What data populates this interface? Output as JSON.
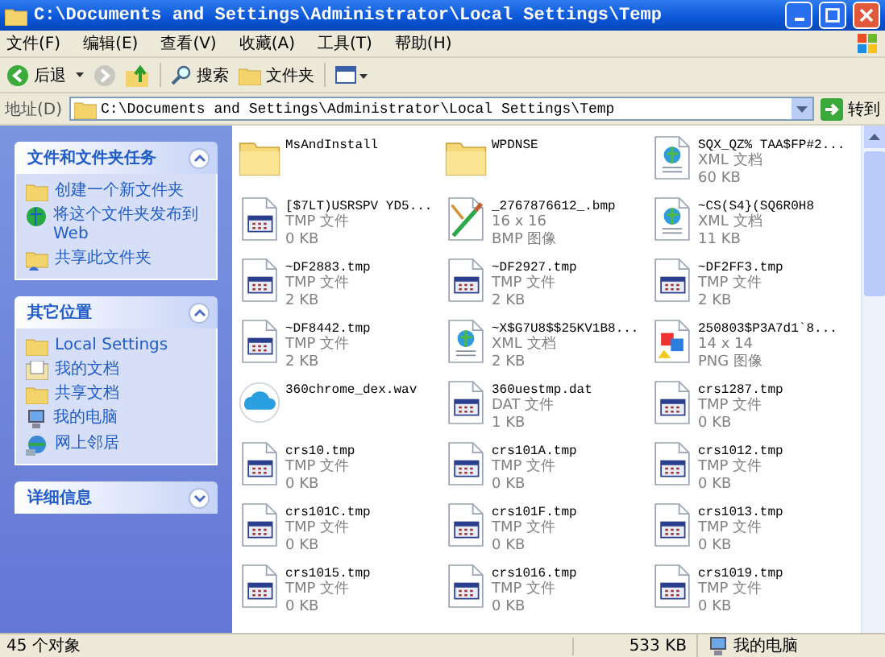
{
  "window": {
    "title": "C:\\Documents and Settings\\Administrator\\Local Settings\\Temp"
  },
  "menu": [
    "文件(F)",
    "编辑(E)",
    "查看(V)",
    "收藏(A)",
    "工具(T)",
    "帮助(H)"
  ],
  "toolbar": {
    "back": "后退",
    "search": "搜索",
    "folders": "文件夹"
  },
  "address": {
    "label": "地址(D)",
    "value": "C:\\Documents and Settings\\Administrator\\Local Settings\\Temp",
    "go": "转到"
  },
  "sidebar": {
    "sections": [
      {
        "title": "文件和文件夹任务",
        "expanded": true,
        "items": [
          {
            "kind": "new-folder",
            "label": "创建一个新文件夹"
          },
          {
            "kind": "publish",
            "label": "将这个文件夹发布到 Web"
          },
          {
            "kind": "share",
            "label": "共享此文件夹"
          }
        ]
      },
      {
        "title": "其它位置",
        "expanded": true,
        "items": [
          {
            "kind": "folder",
            "label": "Local Settings"
          },
          {
            "kind": "documents",
            "label": "我的文档"
          },
          {
            "kind": "folder",
            "label": "共享文档"
          },
          {
            "kind": "computer",
            "label": "我的电脑"
          },
          {
            "kind": "network",
            "label": "网上邻居"
          }
        ]
      },
      {
        "title": "详细信息",
        "expanded": false
      }
    ]
  },
  "files": [
    {
      "kind": "folder",
      "name": "MsAndInstall"
    },
    {
      "kind": "folder",
      "name": "WPDNSE"
    },
    {
      "kind": "xml",
      "name": "SQX_QZ% TAA$FP#2...",
      "lines": [
        "XML 文档",
        "60 KB"
      ]
    },
    {
      "kind": "tmp",
      "name": "[$7LT)USRSPV YD5...",
      "lines": [
        "TMP 文件",
        "0 KB"
      ]
    },
    {
      "kind": "bmp",
      "name": "_2767876612_.bmp",
      "lines": [
        "16 x 16",
        "BMP 图像"
      ]
    },
    {
      "kind": "xml",
      "name": "~CS(S4}(SQ6R0H8",
      "lines": [
        "XML 文档",
        "11 KB"
      ]
    },
    {
      "kind": "tmp",
      "name": "~DF2883.tmp",
      "lines": [
        "TMP 文件",
        "2 KB"
      ]
    },
    {
      "kind": "tmp",
      "name": "~DF2927.tmp",
      "lines": [
        "TMP 文件",
        "2 KB"
      ]
    },
    {
      "kind": "tmp",
      "name": "~DF2FF3.tmp",
      "lines": [
        "TMP 文件",
        "2 KB"
      ]
    },
    {
      "kind": "tmp",
      "name": "~DF8442.tmp",
      "lines": [
        "TMP 文件",
        "2 KB"
      ]
    },
    {
      "kind": "xml",
      "name": "~X$G7U8$$25KV1B8...",
      "lines": [
        "XML 文档",
        "2 KB"
      ]
    },
    {
      "kind": "png",
      "name": "250803$P3A7d1`8...",
      "lines": [
        "14 x 14",
        "PNG 图像"
      ]
    },
    {
      "kind": "wav",
      "name": "360chrome_dex.wav"
    },
    {
      "kind": "tmp",
      "name": "360uestmp.dat",
      "lines": [
        "DAT 文件",
        "1 KB"
      ]
    },
    {
      "kind": "tmp",
      "name": "crs1287.tmp",
      "lines": [
        "TMP 文件",
        "0 KB"
      ]
    },
    {
      "kind": "tmp",
      "name": "crs10.tmp",
      "lines": [
        "TMP 文件",
        "0 KB"
      ]
    },
    {
      "kind": "tmp",
      "name": "crs101A.tmp",
      "lines": [
        "TMP 文件",
        "0 KB"
      ]
    },
    {
      "kind": "tmp",
      "name": "crs1012.tmp",
      "lines": [
        "TMP 文件",
        "0 KB"
      ]
    },
    {
      "kind": "tmp",
      "name": "crs101C.tmp",
      "lines": [
        "TMP 文件",
        "0 KB"
      ]
    },
    {
      "kind": "tmp",
      "name": "crs101F.tmp",
      "lines": [
        "TMP 文件",
        "0 KB"
      ]
    },
    {
      "kind": "tmp",
      "name": "crs1013.tmp",
      "lines": [
        "TMP 文件",
        "0 KB"
      ]
    },
    {
      "kind": "tmp",
      "name": "crs1015.tmp",
      "lines": [
        "TMP 文件",
        "0 KB"
      ]
    },
    {
      "kind": "tmp",
      "name": "crs1016.tmp",
      "lines": [
        "TMP 文件",
        "0 KB"
      ]
    },
    {
      "kind": "tmp",
      "name": "crs1019.tmp",
      "lines": [
        "TMP 文件",
        "0 KB"
      ]
    }
  ],
  "status_bar": {
    "count": "45 个对象",
    "size": "533 KB",
    "location": "我的电脑"
  }
}
